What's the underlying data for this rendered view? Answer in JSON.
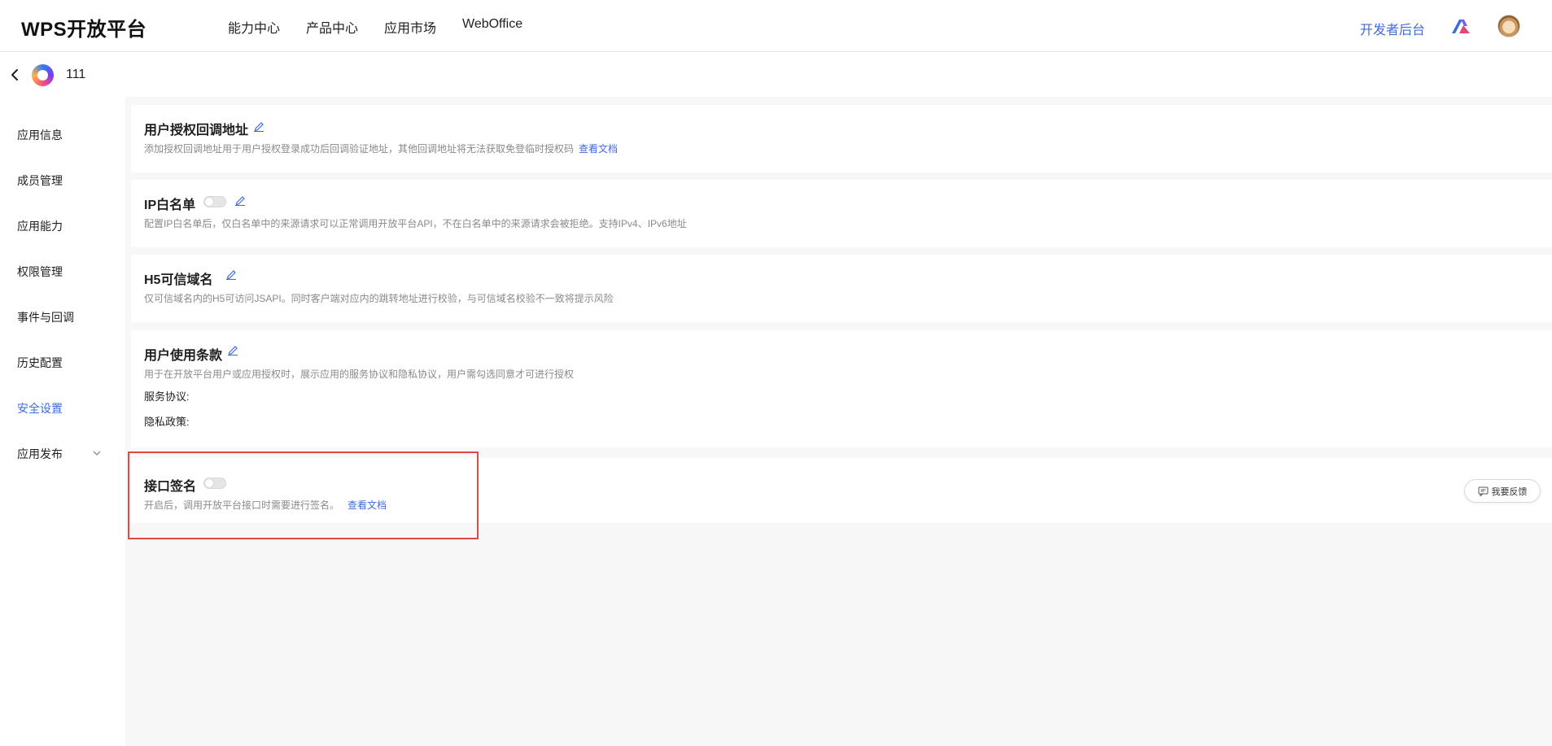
{
  "brand": "WPS开放平台",
  "nav": {
    "items": [
      {
        "label": "能力中心"
      },
      {
        "label": "产品中心"
      },
      {
        "label": "应用市场"
      },
      {
        "label": "WebOffice"
      }
    ],
    "dev_console": "开发者后台"
  },
  "app": {
    "name": "111"
  },
  "sidebar": {
    "items": [
      {
        "label": "应用信息"
      },
      {
        "label": "成员管理"
      },
      {
        "label": "应用能力"
      },
      {
        "label": "权限管理"
      },
      {
        "label": "事件与回调"
      },
      {
        "label": "历史配置"
      },
      {
        "label": "安全设置",
        "active": true
      },
      {
        "label": "应用发布",
        "expandable": true
      }
    ]
  },
  "cards": {
    "oauth": {
      "title": "用户授权回调地址",
      "desc": "添加授权回调地址用于用户授权登录成功后回调验证地址，其他回调地址将无法获取免登临时授权码",
      "link": "查看文档"
    },
    "ip": {
      "title": "IP白名单",
      "enabled": false,
      "desc": "配置IP白名单后，仅白名单中的来源请求可以正常调用开放平台API，不在白名单中的来源请求会被拒绝。支持IPv4、IPv6地址"
    },
    "h5": {
      "title": "H5可信域名",
      "desc": "仅可信域名内的H5可访问JSAPI。同时客户端对应内的跳转地址进行校验，与可信域名校验不一致将提示风险"
    },
    "terms": {
      "title": "用户使用条款",
      "desc": "用于在开放平台用户或应用授权时，展示应用的服务协议和隐私协议，用户需勾选同意才可进行授权",
      "service_label": "服务协议:",
      "privacy_label": "隐私政策:"
    },
    "sign": {
      "title": "接口签名",
      "enabled": false,
      "desc": "开启后，调用开放平台接口时需要进行签名。",
      "link": "查看文档"
    }
  },
  "feedback": "我要反馈",
  "colors": {
    "accent": "#3f6be0",
    "highlight": "#e04848",
    "background": "#f7f7f8"
  }
}
